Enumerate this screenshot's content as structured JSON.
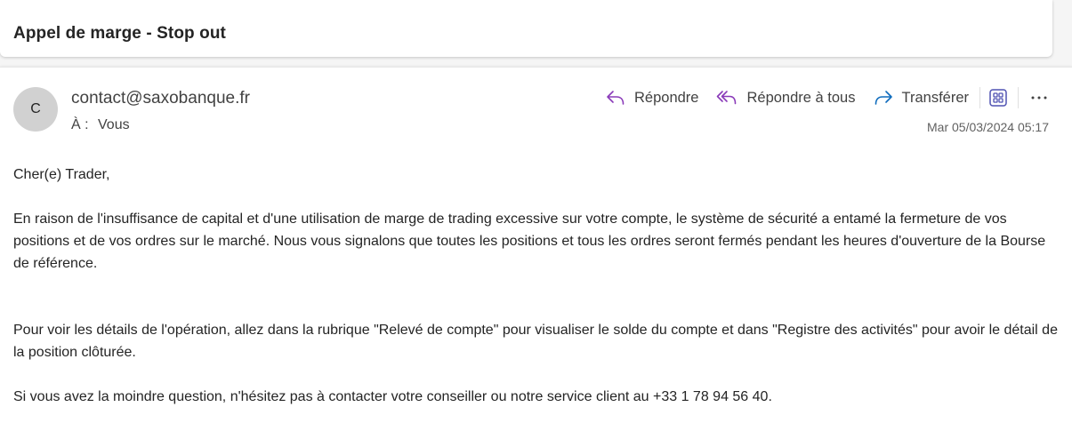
{
  "subject": "Appel de marge - Stop out",
  "sender": {
    "avatar_initial": "C",
    "email": "contact@saxobanque.fr",
    "to_label": "À :",
    "to_value": "Vous"
  },
  "actions": {
    "reply": "Répondre",
    "reply_all": "Répondre à tous",
    "forward": "Transférer",
    "apps_icon": "apps-grid-icon",
    "more_icon": "more-horizontal-icon"
  },
  "date": "Mar 05/03/2024 05:17",
  "body": {
    "greeting": "Cher(e) Trader,",
    "paragraph1": "En raison de l'insuffisance de capital et d'une utilisation de marge de trading excessive sur votre compte, le système de sécurité a entamé la fermeture de vos positions et de vos ordres sur le marché. Nous vous signalons que toutes les positions et tous les ordres seront fermés pendant les heures d'ouverture de la Bourse de référence.",
    "paragraph2": "Pour voir les détails de l'opération, allez dans la rubrique \"Relevé de compte\" pour visualiser le solde du compte et dans \"Registre des activités\" pour avoir le détail de la position clôturée.",
    "paragraph3": "Si vous avez la moindre question, n'hésitez pas à contacter votre conseiller ou notre service client au +33 1 78 94 56 40."
  },
  "colors": {
    "accent_purple": "#8a3ab9",
    "forward_blue": "#0f6cbd",
    "apps_blue": "#4f52b2",
    "avatar_bg": "#d1d1d1"
  }
}
